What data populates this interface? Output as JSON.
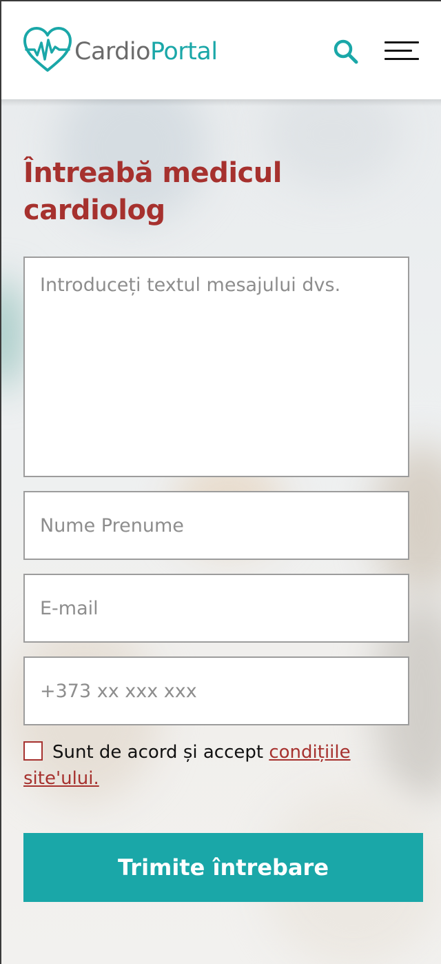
{
  "header": {
    "logo_part1": "Cardio",
    "logo_part2": "Portal",
    "search_icon": "magnifier",
    "menu_icon": "hamburger"
  },
  "colors": {
    "brand_teal": "#1aa7a8",
    "accent_red": "#a6312e",
    "logo_gray": "#6b6b6b"
  },
  "form": {
    "title": "Întreabă medicul cardiolog",
    "message_placeholder": "Introduceți textul mesajului dvs.",
    "name_placeholder": "Nume Prenume",
    "email_placeholder": "E-mail",
    "phone_placeholder": "+373 xx xxx xxx",
    "consent_text": "Sunt de acord și accept ",
    "consent_link": "condițiile site'ului.",
    "consent_checked": false,
    "submit_label": "Trimite întrebare"
  }
}
